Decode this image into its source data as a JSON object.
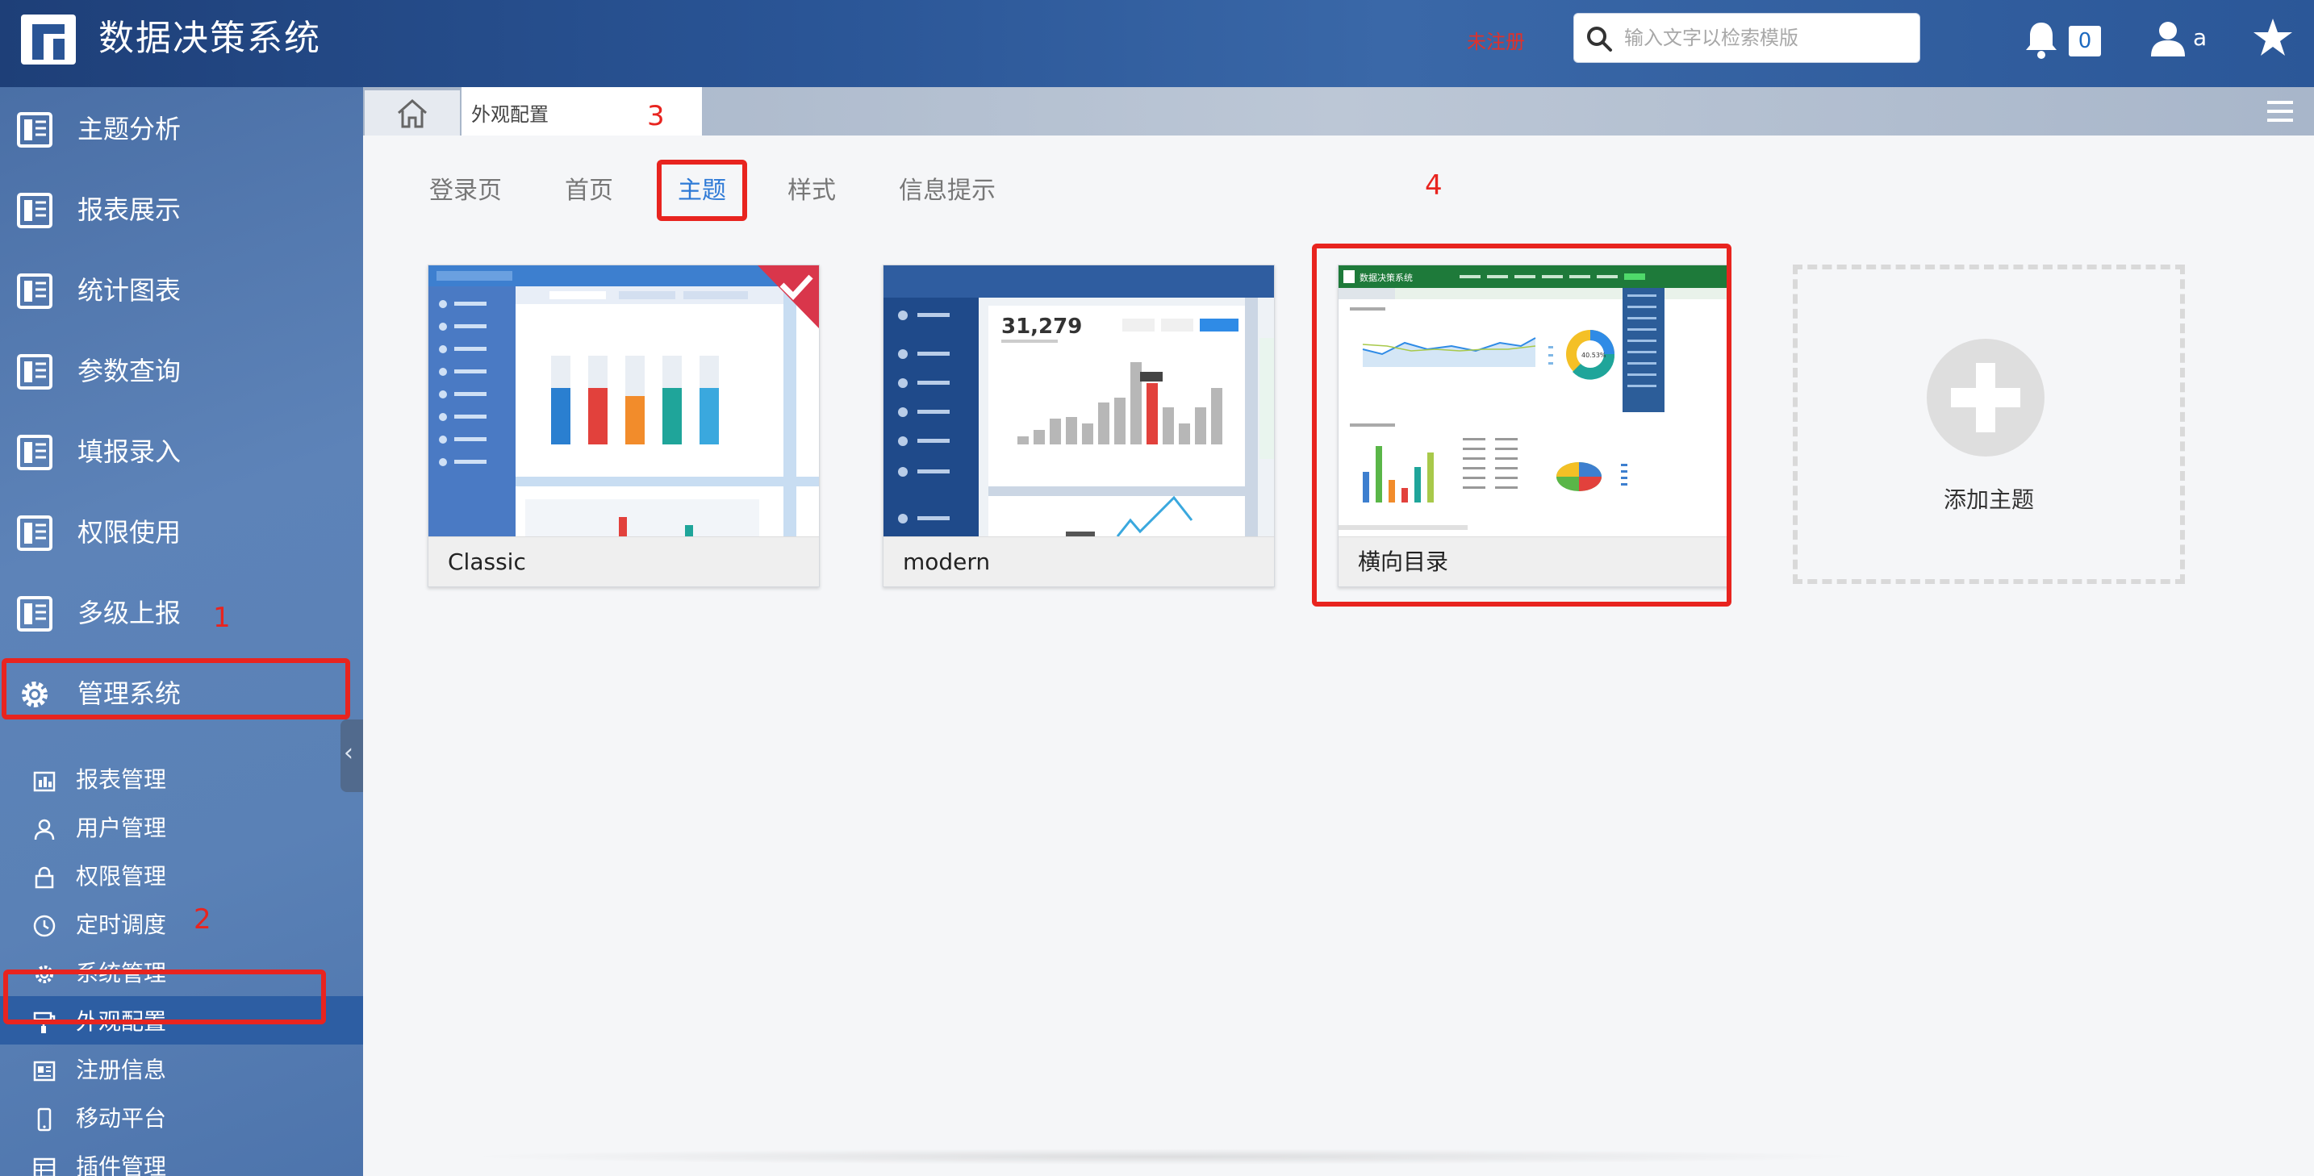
{
  "header": {
    "title": "数据决策系统",
    "unregistered": "未注册",
    "search_placeholder": "输入文字以检索模版",
    "notification_count": "0",
    "user_name": "a"
  },
  "sidebar": {
    "main_items": [
      {
        "label": "主题分析"
      },
      {
        "label": "报表展示"
      },
      {
        "label": "统计图表"
      },
      {
        "label": "参数查询"
      },
      {
        "label": "填报录入"
      },
      {
        "label": "权限使用"
      },
      {
        "label": "多级上报"
      },
      {
        "label": "管理系统"
      }
    ],
    "sub_items": [
      {
        "label": "报表管理"
      },
      {
        "label": "用户管理"
      },
      {
        "label": "权限管理"
      },
      {
        "label": "定时调度"
      },
      {
        "label": "系统管理"
      },
      {
        "label": "外观配置",
        "active": true
      },
      {
        "label": "注册信息"
      },
      {
        "label": "移动平台"
      },
      {
        "label": "插件管理"
      }
    ]
  },
  "tabbar": {
    "current_tab": "外观配置"
  },
  "subtabs": [
    {
      "label": "登录页"
    },
    {
      "label": "首页"
    },
    {
      "label": "主题",
      "active": true
    },
    {
      "label": "样式"
    },
    {
      "label": "信息提示"
    }
  ],
  "themes": [
    {
      "label": "Classic",
      "selected": true
    },
    {
      "label": "modern"
    },
    {
      "label": "横向目录"
    }
  ],
  "modern_preview_value": "31,279",
  "thumb_text": {
    "horizontal_title": "数据决策系统",
    "donut_center": "40.53%"
  },
  "add_theme_label": "添加主题",
  "annotations": [
    "1",
    "2",
    "3",
    "4"
  ],
  "colors": {
    "accent": "#2d79d6",
    "annotation": "#e8241f",
    "header": "#2a5596",
    "sidebar": "#5a81b6"
  }
}
